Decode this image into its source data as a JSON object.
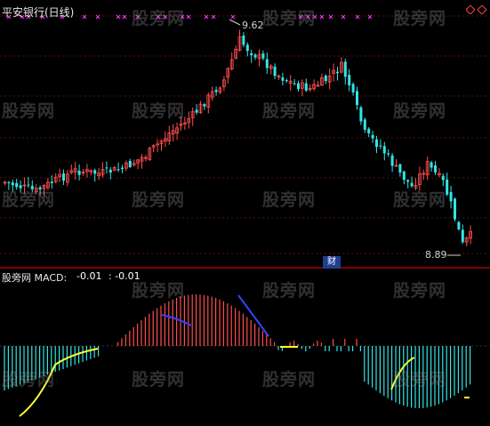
{
  "window": {
    "title": "平安银行(日线)"
  },
  "indicator": {
    "name_label": "股旁网 MACD:",
    "macd_value": "-0.01",
    "signal_value": ": -0.01"
  },
  "markers": {
    "high_label": "9.62",
    "low_label": "8.89",
    "finance_badge": "财"
  },
  "watermark": {
    "text": "股旁网"
  },
  "colors": {
    "background": "#000000",
    "up": "#ff4d4d",
    "down": "#33e5e5",
    "signal_marks": "#ff33ff",
    "panel_divider": "#cc0000",
    "macd_line_up": "#3344ff",
    "macd_line_down": "#ffff33"
  },
  "icons": {
    "top_right": [
      "diamond-outline-icon",
      "diamond-outline-icon"
    ]
  }
}
